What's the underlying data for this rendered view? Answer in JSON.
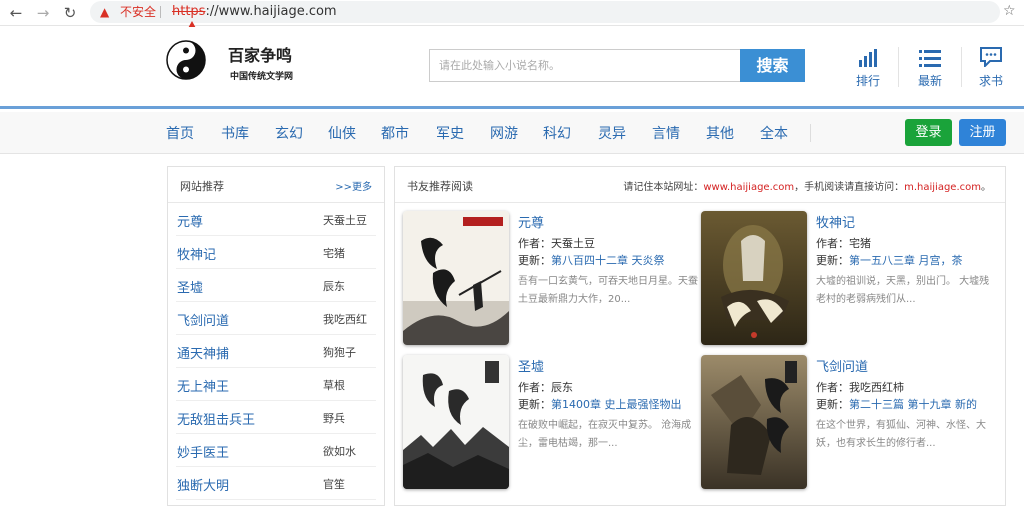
{
  "browser": {
    "insecure_label": "不安全",
    "url_scheme": "https",
    "url_rest": "://www.haijiage.com"
  },
  "site": {
    "name": "百家争鸣",
    "subtitle": "中国传统文学网"
  },
  "search": {
    "placeholder": "请在此处输入小说名称。",
    "button": "搜索"
  },
  "header_tools": [
    {
      "label": "排行",
      "icon": "bar-chart-icon"
    },
    {
      "label": "最新",
      "icon": "list-icon"
    },
    {
      "label": "求书",
      "icon": "chat-icon"
    }
  ],
  "nav": [
    "首页",
    "书库",
    "玄幻",
    "仙侠",
    "都市",
    "军史",
    "网游",
    "科幻",
    "灵异",
    "言情",
    "其他",
    "全本"
  ],
  "auth": {
    "login": "登录",
    "register": "注册"
  },
  "recommend": {
    "title": "网站推荐",
    "more": ">>更多",
    "items": [
      {
        "title": "元尊",
        "author": "天蚕土豆"
      },
      {
        "title": "牧神记",
        "author": "宅猪"
      },
      {
        "title": "圣墟",
        "author": "辰东"
      },
      {
        "title": "飞剑问道",
        "author": "我吃西红"
      },
      {
        "title": "通天神捕",
        "author": "狗狍子"
      },
      {
        "title": "无上神王",
        "author": "草根"
      },
      {
        "title": "无敌狙击兵王",
        "author": "野兵"
      },
      {
        "title": "妙手医王",
        "author": "欲如水"
      },
      {
        "title": "独断大明",
        "author": "官笙"
      }
    ]
  },
  "reader": {
    "title": "书友推荐阅读",
    "notice_prefix": "请记住本站网址：",
    "notice_site": "www.haijiage.com",
    "notice_mid": "，手机阅读请直接访问：",
    "notice_mobile": "m.haijiage.com",
    "notice_end": "。",
    "author_label": "作者：",
    "update_label": "更新：",
    "books": [
      {
        "title": "元尊",
        "author": "天蚕土豆",
        "chapter": "第八百四十二章 天炎祭",
        "desc": "吾有一口玄黄气，可吞天地日月星。天蚕土豆最新鼎力大作，20..."
      },
      {
        "title": "牧神记",
        "author": "宅猪",
        "chapter": "第一五八三章 月宫，茶",
        "desc": "大墟的祖训说，天黑，别出门。 大墟残老村的老弱病残们从..."
      },
      {
        "title": "圣墟",
        "author": "辰东",
        "chapter": "第1400章 史上最强怪物出",
        "desc": "在破败中崛起，在寂灭中复苏。 沧海成尘，雷电枯竭，那一..."
      },
      {
        "title": "飞剑问道",
        "author": "我吃西红柿",
        "chapter": "第二十三篇 第十九章 新的",
        "desc": "在这个世界，有狐仙、河神、水怪、大妖，也有求长生的修行者..."
      }
    ]
  }
}
